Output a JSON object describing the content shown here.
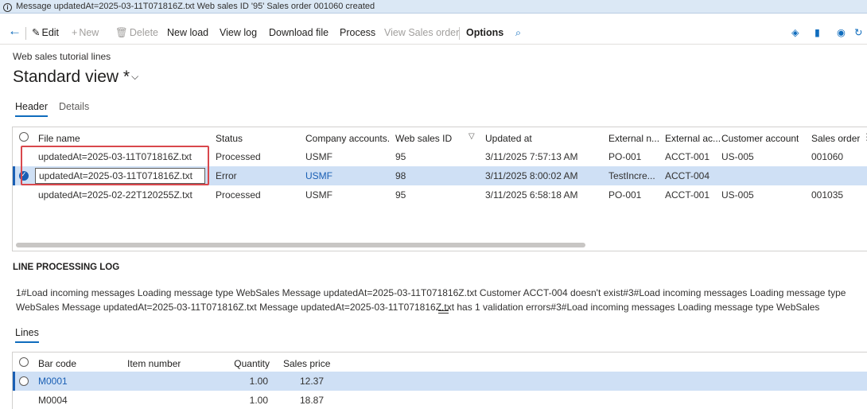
{
  "message_bar": {
    "text": "Message updatedAt=2025-03-11T071816Z.txt  Web sales ID '95' Sales order 001060 created"
  },
  "toolbar": {
    "back_icon": "back-arrow-icon",
    "edit_label": "Edit",
    "new_label": "New",
    "delete_label": "Delete",
    "new_load_label": "New load",
    "view_log_label": "View log",
    "download_file_label": "Download file",
    "process_label": "Process",
    "view_sales_order_label": "View Sales order",
    "options_label": "Options"
  },
  "page": {
    "caption": "Web sales tutorial lines",
    "view_title": "Standard view *"
  },
  "tabs": {
    "header": "Header",
    "details": "Details"
  },
  "header_grid": {
    "columns": [
      "File name",
      "Status",
      "Company accounts...",
      "Web sales ID",
      "Updated at",
      "External n...",
      "External ac...",
      "Customer account",
      "Sales order"
    ],
    "rows": [
      {
        "file": "updatedAt=2025-03-11T071816Z.txt",
        "status": "Processed",
        "company": "USMF",
        "web_sales_id": "95",
        "updated": "3/11/2025 7:57:13 AM",
        "ext_n": "PO-001",
        "ext_ac": "ACCT-001",
        "customer": "US-005",
        "sales_order": "001060"
      },
      {
        "file": "updatedAt=2025-03-11T071816Z.txt",
        "status": "Error",
        "company": "USMF",
        "web_sales_id": "98",
        "updated": "3/11/2025 8:00:02 AM",
        "ext_n": "TestIncre...",
        "ext_ac": "ACCT-004",
        "customer": "",
        "sales_order": ""
      },
      {
        "file": "updatedAt=2025-02-22T120255Z.txt",
        "status": "Processed",
        "company": "USMF",
        "web_sales_id": "95",
        "updated": "3/11/2025 6:58:18 AM",
        "ext_n": "PO-001",
        "ext_ac": "ACCT-001",
        "customer": "US-005",
        "sales_order": "001035"
      }
    ]
  },
  "log": {
    "title": "LINE PROCESSING LOG",
    "text": "1#Load incoming messages   Loading message type WebSales   Message updatedAt=2025-03-11T071816Z.txt    Customer ACCT-004 doesn't exist#3#Load incoming messages   Loading message type WebSales Message updatedAt=2025-03-11T071816Z.txt      Message updatedAt=2025-03-11T071816Z.txt has 1 validation errors#3#Load incoming messages   Loading message type WebSales"
  },
  "lines": {
    "tab_label": "Lines",
    "columns": [
      "Bar code",
      "Item number",
      "Quantity",
      "Sales price"
    ],
    "rows": [
      {
        "bar_code": "M0001",
        "item_number": "",
        "quantity": "1.00",
        "price": "12.37"
      },
      {
        "bar_code": "M0004",
        "item_number": "",
        "quantity": "1.00",
        "price": "18.87"
      }
    ]
  },
  "colors": {
    "accent": "#1a5fb4",
    "selected_row": "#cfe0f5",
    "highlight_box": "#d9474c",
    "message_bar": "#dbe8f5"
  }
}
